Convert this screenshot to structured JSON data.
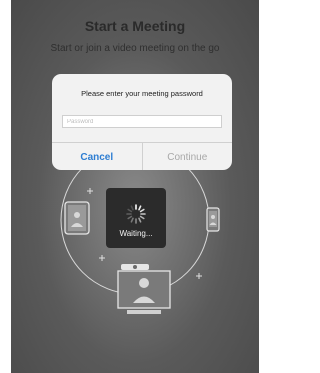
{
  "header": {
    "title": "Start a Meeting",
    "subtitle": "Start or join a video meeting on the go"
  },
  "dialog": {
    "message": "Please enter your meeting password",
    "password_placeholder": "Password",
    "password_value": "",
    "cancel_label": "Cancel",
    "continue_label": "Continue"
  },
  "loading": {
    "label": "Waiting...",
    "icon": "spinner-icon"
  },
  "illustration": {
    "icons": [
      "tablet-icon",
      "phone-icon",
      "room-system-icon",
      "plus-icon"
    ]
  },
  "colors": {
    "accent": "#2d7dd2",
    "disabled": "#a8a8a8",
    "overlay": "#5a5a5a"
  }
}
